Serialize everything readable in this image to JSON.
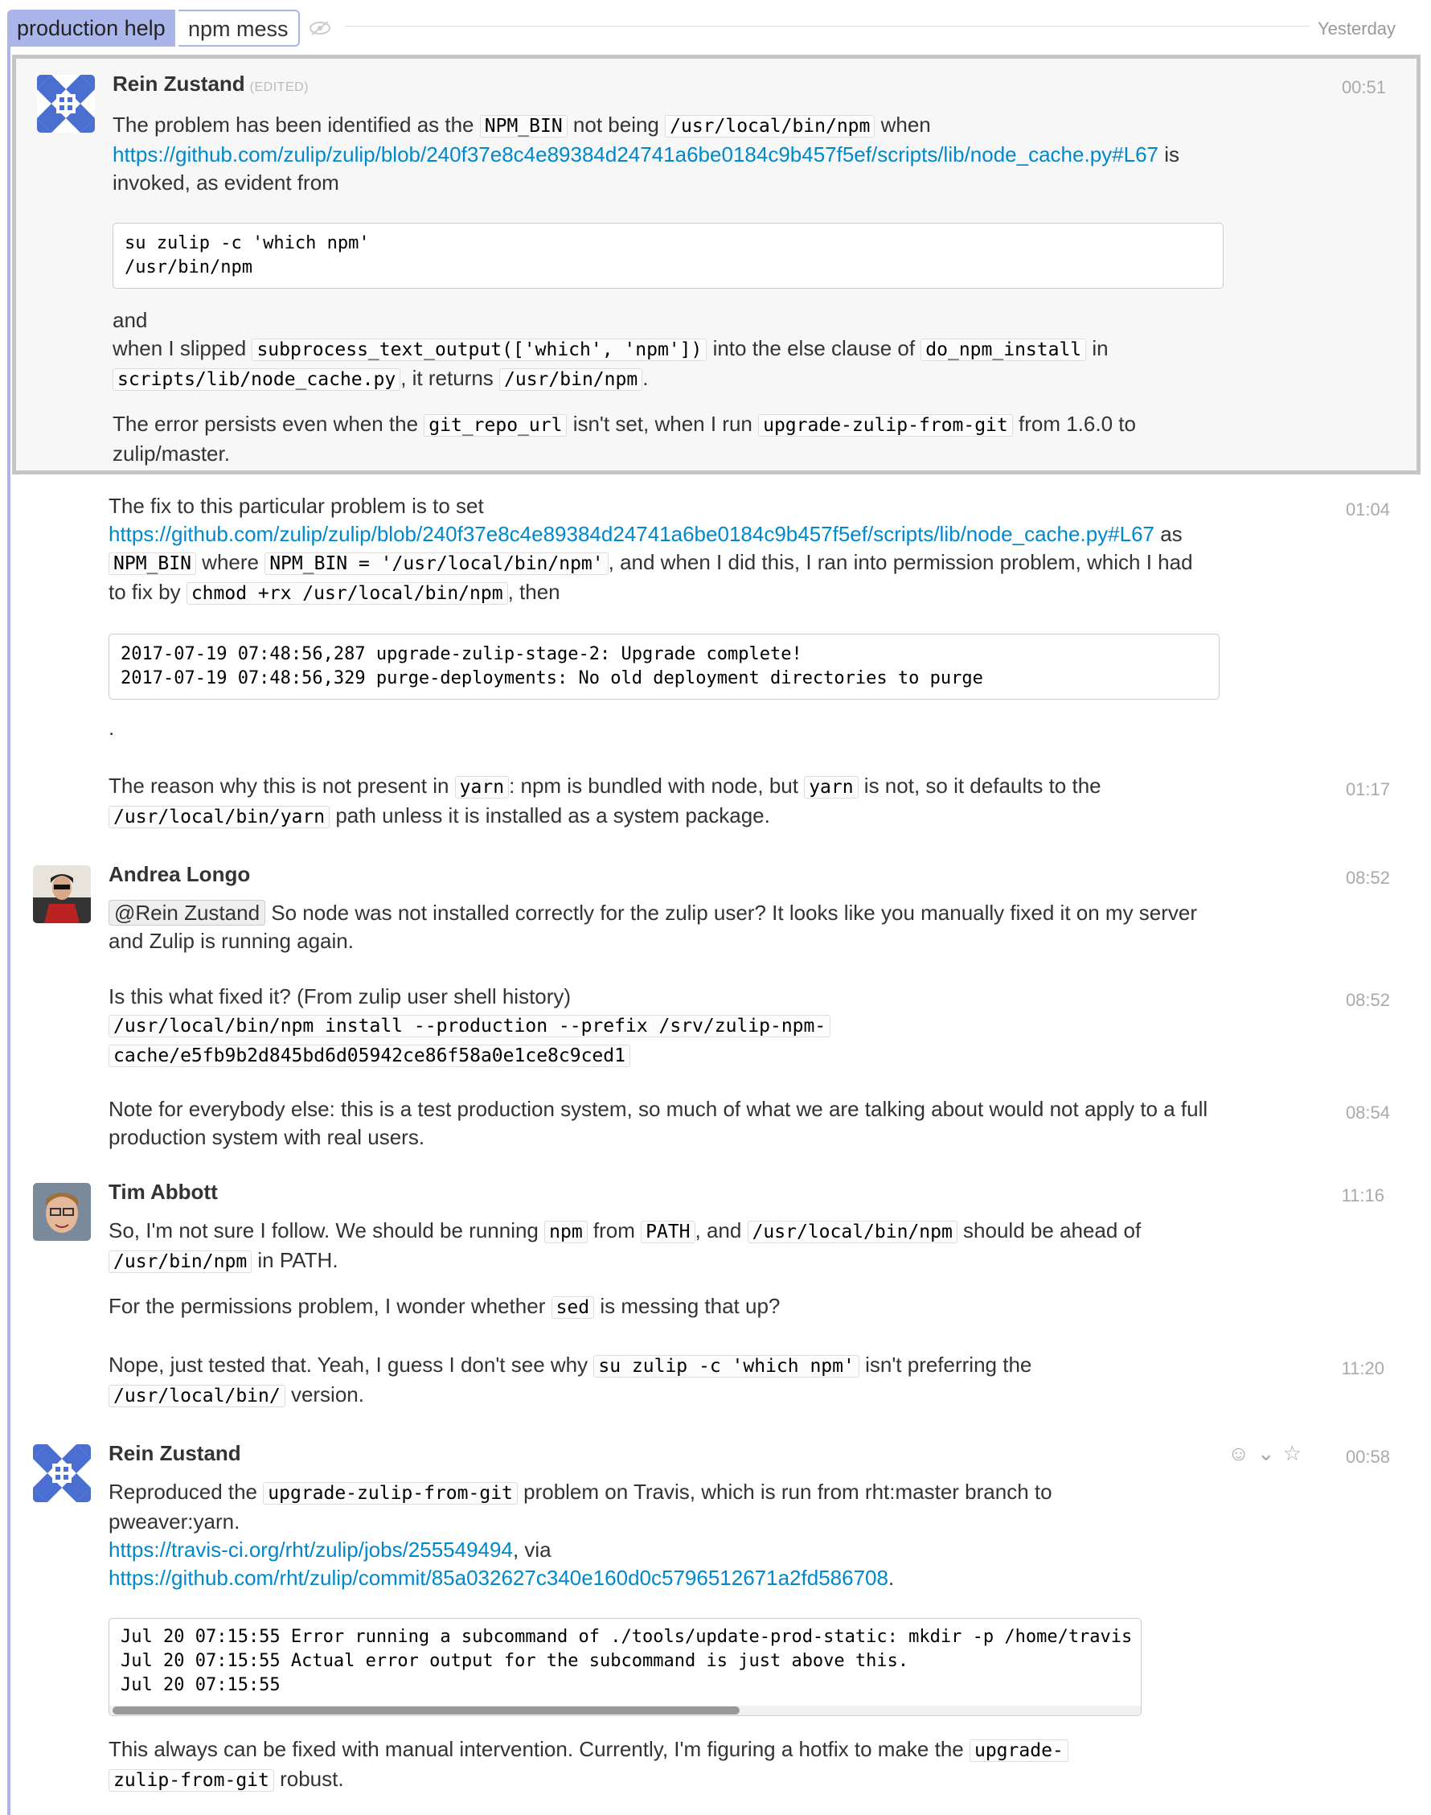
{
  "header": {
    "stream": "production help",
    "topic": "npm mess",
    "date": "Yesterday"
  },
  "msg1": {
    "sender": "Rein Zustand",
    "edited": "(EDITED)",
    "time": "00:51",
    "p1_a": "The problem has been identified as the ",
    "p1_code1": "NPM_BIN",
    "p1_b": " not being ",
    "p1_code2": "/usr/local/bin/npm",
    "p1_c": " when",
    "p1_link": "https://github.com/zulip/zulip/blob/240f37e8c4e89384d24741a6be0184c9b457f5ef/scripts/lib/node_cache.py#L67",
    "p1_d": " is",
    "p1_e": "invoked, as evident from",
    "pre": "su zulip -c 'which npm'\n/usr/bin/npm",
    "p2_a": "and",
    "p2_b": "when I slipped ",
    "p2_code1": "subprocess_text_output(['which', 'npm'])",
    "p2_c": " into the else clause of ",
    "p2_code2": "do_npm_install",
    "p2_d": " in",
    "p2_code3": "scripts/lib/node_cache.py",
    "p2_e": ", it returns ",
    "p2_code4": "/usr/bin/npm",
    "p2_f": ".",
    "p3_a": "The error persists even when the ",
    "p3_code1": "git_repo_url",
    "p3_b": " isn't set, when I run ",
    "p3_code2": "upgrade-zulip-from-git",
    "p3_c": " from 1.6.0 to",
    "p3_d": "zulip/master."
  },
  "msg2": {
    "time": "01:04",
    "p1_a": "The fix to this particular problem is to set",
    "p1_link": "https://github.com/zulip/zulip/blob/240f37e8c4e89384d24741a6be0184c9b457f5ef/scripts/lib/node_cache.py#L67",
    "p1_b": " as",
    "p1_code1": "NPM_BIN",
    "p1_c": " where ",
    "p1_code2": "NPM_BIN = '/usr/local/bin/npm'",
    "p1_d": ", and when I did this, I ran into permission problem, which I had",
    "p1_e": "to fix by ",
    "p1_code3": "chmod +rx /usr/local/bin/npm",
    "p1_f": ", then",
    "pre": "2017-07-19 07:48:56,287 upgrade-zulip-stage-2: Upgrade complete!\n2017-07-19 07:48:56,329 purge-deployments: No old deployment directories to purge",
    "dot": "."
  },
  "msg3": {
    "time": "01:17",
    "a": "The reason why this is not present in ",
    "code1": "yarn",
    "b": ": npm is bundled with node, but ",
    "code2": "yarn",
    "c": " is not, so it defaults to the",
    "code3": "/usr/local/bin/yarn",
    "d": " path unless it is installed as a system package."
  },
  "msg4": {
    "sender": "Andrea Longo",
    "time": "08:52",
    "mention": "@Rein Zustand",
    "a": " So node was not installed correctly for the zulip user? It looks like you manually fixed it on my server",
    "b": "and Zulip is running again."
  },
  "msg5": {
    "time": "08:52",
    "a": "Is this what fixed it? (From zulip user shell history)",
    "code1": "/usr/local/bin/npm install --production --prefix /srv/zulip-npm-",
    "code2": "cache/e5fb9b2d845bd6d05942ce86f58a0e1ce8c9ced1"
  },
  "msg6": {
    "time": "08:54",
    "a": "Note for everybody else: this is a test production system, so much of what we are talking about would not apply to a full",
    "b": "production system with real users."
  },
  "msg7": {
    "sender": "Tim Abbott",
    "time": "11:16",
    "a": "So, I'm not sure I follow. We should be running ",
    "code1": "npm",
    "b": " from ",
    "code2": "PATH",
    "c": ", and ",
    "code3": "/usr/local/bin/npm",
    "d": " should be ahead of",
    "code4": "/usr/bin/npm",
    "e": " in PATH.",
    "f": "For the permissions problem, I wonder whether ",
    "code5": "sed",
    "g": " is messing that up?"
  },
  "msg8": {
    "time": "11:20",
    "a": "Nope, just tested that. Yeah, I guess I don't see why ",
    "code1": "su zulip -c 'which npm'",
    "b": " isn't preferring the",
    "code2": "/usr/local/bin/",
    "c": " version."
  },
  "msg9": {
    "sender": "Rein Zustand",
    "time": "00:58",
    "a": "Reproduced the ",
    "code1": "upgrade-zulip-from-git",
    "b": " problem on Travis, which is run from rht:master branch to",
    "c": "pweaver:yarn.",
    "link1": "https://travis-ci.org/rht/zulip/jobs/255549494",
    "d": ", via",
    "link2": "https://github.com/rht/zulip/commit/85a032627c340e160d0c5796512671a2fd586708",
    "e": ".",
    "pre": "Jul 20 07:15:55 Error running a subcommand of ./tools/update-prod-static: mkdir -p /home/travis\nJul 20 07:15:55 Actual error output for the subcommand is just above this.\nJul 20 07:15:55",
    "f": "This always can be fixed with manual intervention. Currently, I'm figuring a hotfix to make the ",
    "code2": "upgrade-",
    "code3": "zulip-from-git",
    "g": " robust."
  }
}
